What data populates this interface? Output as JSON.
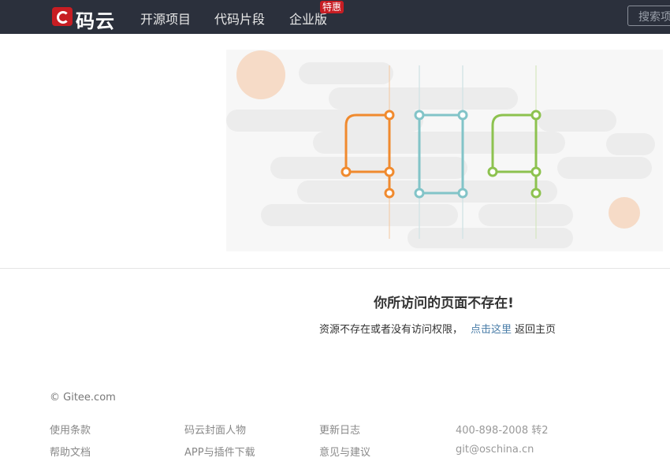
{
  "header": {
    "logo_text": "码云",
    "nav": {
      "open_source": "开源项目",
      "code_snippets": "代码片段",
      "enterprise": "企业版",
      "promo_badge": "特惠"
    },
    "search": {
      "placeholder": "搜索项目"
    }
  },
  "illustration": {
    "code_digits": [
      "4",
      "0",
      "4"
    ],
    "colors": {
      "digit_1": "#f08a2e",
      "digit_2": "#82c4c8",
      "digit_3": "#8dc24f",
      "bubble": "#f6d6be",
      "cloud": "#ececec"
    }
  },
  "message": {
    "title": "你所访问的页面不存在!",
    "description": "资源不存在或者没有访问权限，",
    "link_text": "点击这里",
    "after_link": "返回主页"
  },
  "footer": {
    "copyright": "© Gitee.com",
    "col1": [
      "使用条款",
      "帮助文档"
    ],
    "col2": [
      "码云封面人物",
      "APP与插件下载"
    ],
    "col3": [
      "更新日志",
      "意见与建议"
    ],
    "contact": {
      "phone": "400-898-2008 转2",
      "email": "git@oschina.cn"
    }
  }
}
